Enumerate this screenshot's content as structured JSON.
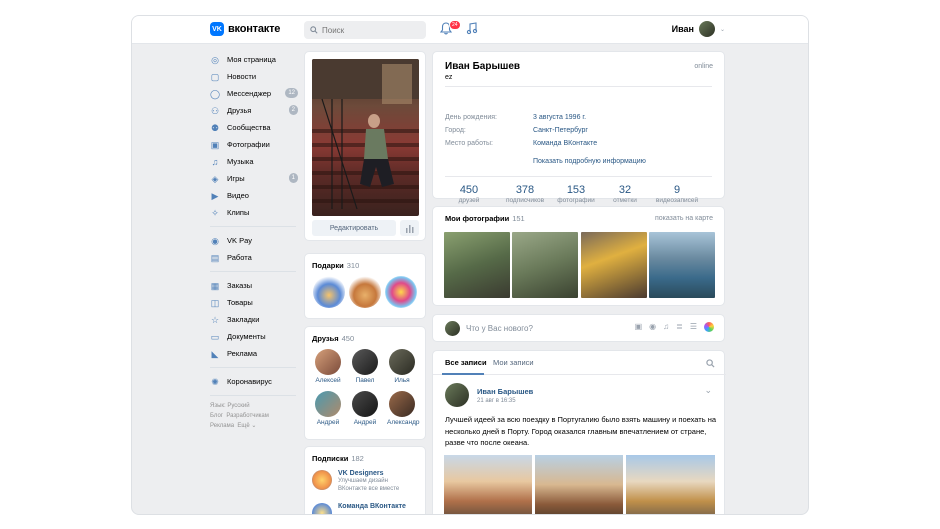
{
  "header": {
    "logo_text": "вконтакте",
    "search_placeholder": "Поиск",
    "notification_count": "24",
    "user_name": "Иван"
  },
  "sidebar": {
    "items": [
      {
        "label": "Моя страница",
        "icon": "user-circle-icon"
      },
      {
        "label": "Новости",
        "icon": "news-icon"
      },
      {
        "label": "Мессенджер",
        "icon": "message-icon",
        "badge": "12"
      },
      {
        "label": "Друзья",
        "icon": "friends-icon",
        "badge": "2"
      },
      {
        "label": "Сообщества",
        "icon": "communities-icon"
      },
      {
        "label": "Фотографии",
        "icon": "photo-icon"
      },
      {
        "label": "Музыка",
        "icon": "music-icon"
      },
      {
        "label": "Игры",
        "icon": "games-icon",
        "badge": "1"
      },
      {
        "label": "Видео",
        "icon": "video-icon"
      },
      {
        "label": "Клипы",
        "icon": "clips-icon"
      }
    ],
    "items2": [
      {
        "label": "VK Pay",
        "icon": "vkpay-icon"
      },
      {
        "label": "Работа",
        "icon": "work-icon"
      }
    ],
    "items3": [
      {
        "label": "Заказы",
        "icon": "orders-icon"
      },
      {
        "label": "Товары",
        "icon": "goods-icon"
      },
      {
        "label": "Закладки",
        "icon": "bookmark-icon"
      },
      {
        "label": "Документы",
        "icon": "docs-icon"
      },
      {
        "label": "Реклама",
        "icon": "ads-icon"
      }
    ],
    "items4": [
      {
        "label": "Коронавирус",
        "icon": "virus-icon"
      }
    ],
    "footer": {
      "line1": "Язык: Русский",
      "line2a": "Блог",
      "line2b": "Разработчикам",
      "line3a": "Реклама",
      "line3b": "Ещё ⌄"
    }
  },
  "left": {
    "edit_button": "Редактировать",
    "gifts_title": "Подарки",
    "gifts_count": "310",
    "friends_title": "Друзья",
    "friends_count": "450",
    "friends": [
      "Алексей",
      "Павел",
      "Илья",
      "Андрей",
      "Андрей",
      "Александр"
    ],
    "subs_title": "Подписки",
    "subs_count": "182",
    "subs": [
      {
        "name": "VK Designers",
        "desc1": "Улучшаем дизайн",
        "desc2": "ВКонтакте все вместе"
      },
      {
        "name": "Команда ВКонтакте"
      }
    ]
  },
  "profile": {
    "name": "Иван Барышев",
    "status": "ez",
    "online": "online",
    "rows": [
      {
        "label": "День рождения:",
        "value": "3 августа 1996 г."
      },
      {
        "label": "Город:",
        "value": "Санкт-Петербург"
      },
      {
        "label": "Место работы:",
        "value": "Команда ВКонтакте"
      }
    ],
    "more": "Показать подробную информацию",
    "counters": [
      {
        "value": "450",
        "label": "друзей"
      },
      {
        "value": "378",
        "label": "подписчиков"
      },
      {
        "value": "153",
        "label": "фотографии"
      },
      {
        "value": "32",
        "label": "отметки"
      },
      {
        "value": "9",
        "label": "видеозаписей"
      }
    ]
  },
  "photos": {
    "title": "Мои фотографии",
    "count": "151",
    "map_link": "показать на карте"
  },
  "composer": {
    "placeholder": "Что у Вас нового?"
  },
  "feed": {
    "tab_all": "Все записи",
    "tab_mine": "Мои записи",
    "post": {
      "author": "Иван Барышев",
      "date": "21 авг в 16:35",
      "text": "Лучшей идеей за всю поездку в Португалию было взять машину и поехать на несколько дней в Порту. Город оказался главным впечатлением от стране, разве что после океана."
    }
  }
}
